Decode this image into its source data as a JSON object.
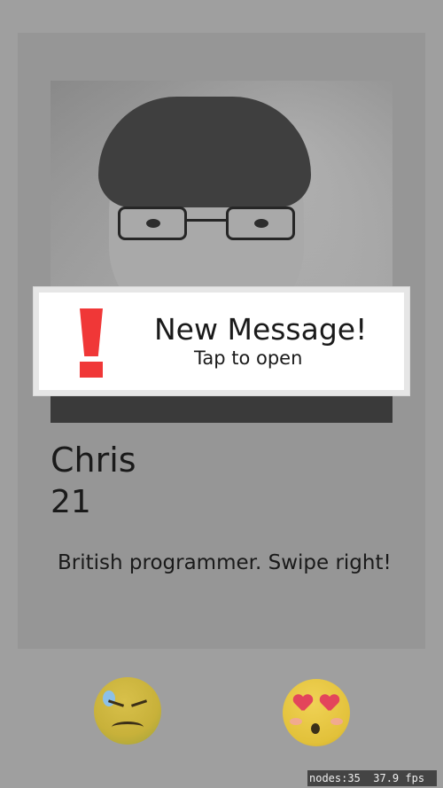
{
  "profile": {
    "name": "Chris",
    "age": "21",
    "bio": "British programmer. Swipe right!"
  },
  "notification": {
    "title": "New Message!",
    "subtitle": "Tap to open",
    "icon": "exclamation-icon",
    "icon_color": "#f03737"
  },
  "actions": {
    "dislike_icon": "confounded-face-emoji",
    "like_icon": "heart-eyes-emoji"
  },
  "debug": {
    "nodes": "nodes:35",
    "fps": "37.9 fps"
  },
  "colors": {
    "background": "#9f9f9f",
    "card": "#969696",
    "notification_bg": "#ffffff"
  }
}
